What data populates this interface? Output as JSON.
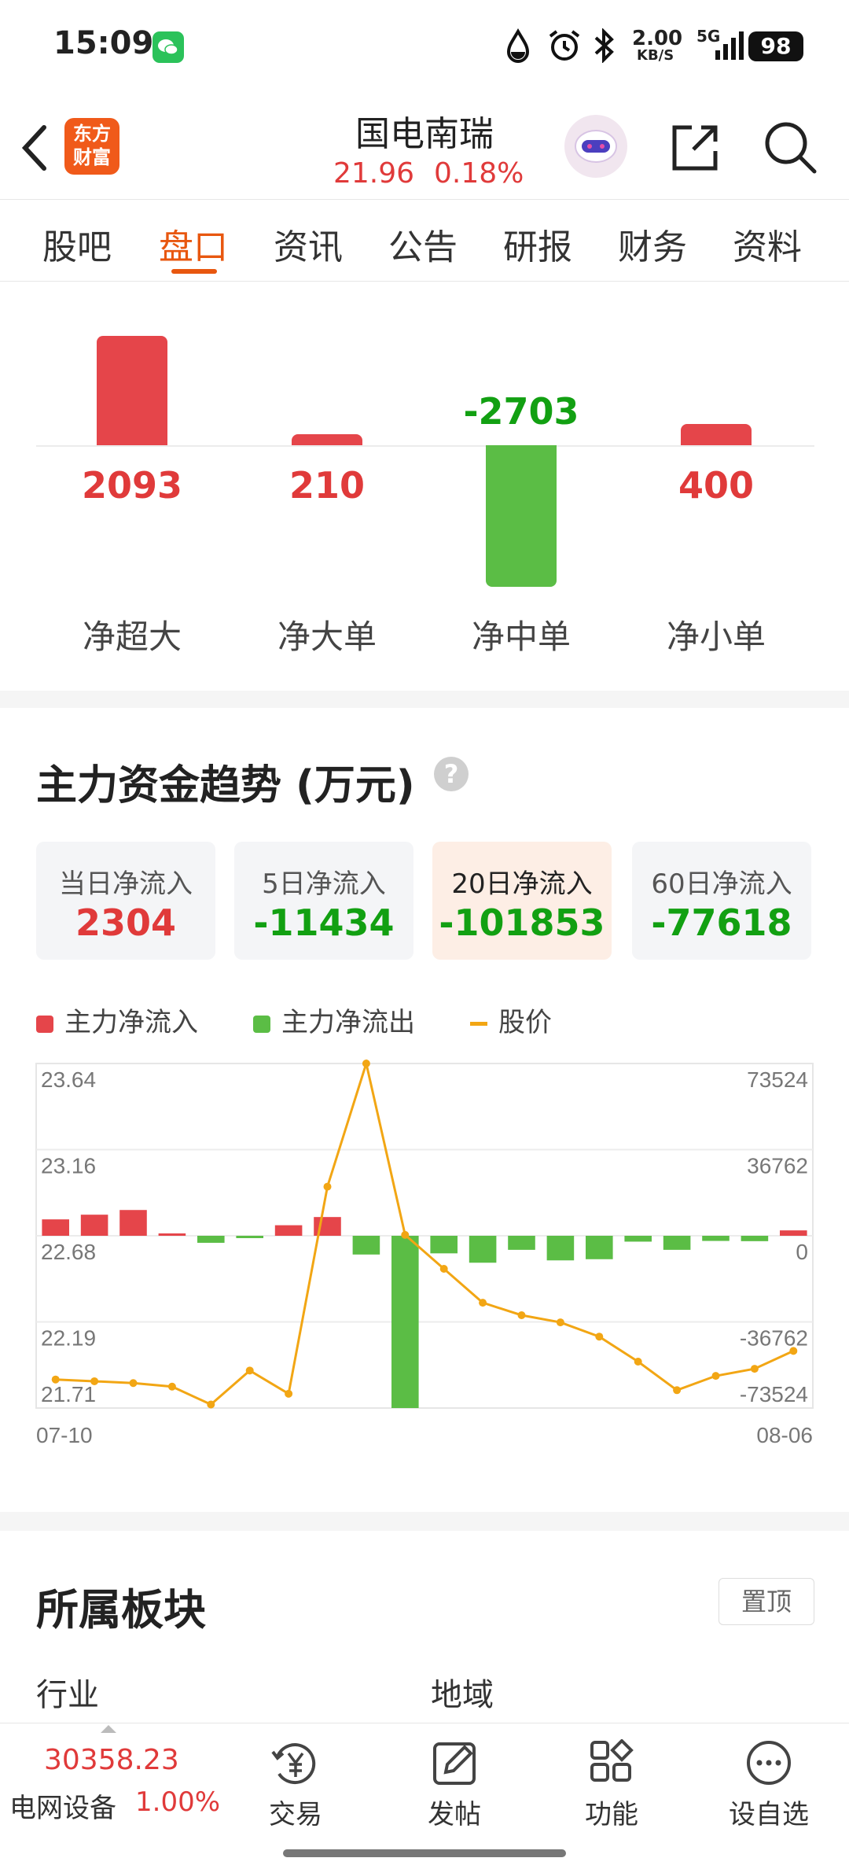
{
  "status_bar": {
    "time": "15:09",
    "net_speed": "2.00",
    "net_unit": "KB/S",
    "network": "5G",
    "battery": "98"
  },
  "header": {
    "logo_line1": "东方",
    "logo_line2": "财富",
    "title": "国电南瑞",
    "price": "21.96",
    "change": "0.18%"
  },
  "tabs": [
    {
      "label": "股吧"
    },
    {
      "label": "盘口"
    },
    {
      "label": "资讯"
    },
    {
      "label": "公告"
    },
    {
      "label": "研报"
    },
    {
      "label": "财务"
    },
    {
      "label": "资料"
    }
  ],
  "active_tab": "盘口",
  "net_flow": {
    "items": [
      {
        "label": "净超大",
        "value": 2093,
        "display": "2093"
      },
      {
        "label": "净大单",
        "value": 210,
        "display": "210"
      },
      {
        "label": "净中单",
        "value": -2703,
        "display": "-2703"
      },
      {
        "label": "净小单",
        "value": 400,
        "display": "400"
      }
    ]
  },
  "trend": {
    "title": "主力资金趋势 (万元)",
    "help_icon": "question-icon",
    "stats": [
      {
        "label": "当日净流入",
        "value": "2304",
        "color": "#e03a3a"
      },
      {
        "label": "5日净流入",
        "value": "-11434",
        "color": "#12a012"
      },
      {
        "label": "20日净流入",
        "value": "-101853",
        "color": "#12a012"
      },
      {
        "label": "60日净流入",
        "value": "-77618",
        "color": "#12a012"
      }
    ],
    "selected_stat": "20日净流入",
    "legend": {
      "inflow": "主力净流入",
      "outflow": "主力净流出",
      "price": "股价"
    }
  },
  "chart_data": {
    "type": "bar+line",
    "x_start": "07-10",
    "x_end": "08-06",
    "left_ticks": [
      "23.64",
      "23.16",
      "22.68",
      "22.19",
      "21.71"
    ],
    "right_ticks": [
      "73524",
      "36762",
      "0",
      "-36762",
      "-73524"
    ],
    "left_range": [
      21.71,
      23.64
    ],
    "right_range": [
      -73524,
      73524
    ],
    "series": [
      {
        "name": "主力净流入/主力净流出",
        "values": [
          7000,
          9000,
          11000,
          500,
          -3000,
          -500,
          4500,
          8000,
          -8000,
          -73524,
          -7500,
          -11500,
          -6000,
          -10500,
          -10000,
          -2500,
          -6000,
          -2200,
          -2300,
          2300
        ]
      },
      {
        "name": "股价",
        "values": [
          21.87,
          21.86,
          21.85,
          21.83,
          21.73,
          21.92,
          21.79,
          22.95,
          23.64,
          22.68,
          22.49,
          22.3,
          22.23,
          22.19,
          22.11,
          21.97,
          21.81,
          21.89,
          21.93,
          22.03
        ]
      }
    ],
    "colors": {
      "inflow": "#e5454a",
      "outflow": "#5bbd45",
      "price": "#f2a614"
    }
  },
  "sector": {
    "title": "所属板块",
    "pin_label": "置顶",
    "industry_label": "行业",
    "region_label": "地域"
  },
  "bottom": {
    "index_value": "30358.23",
    "index_name": "电网设备",
    "index_change": "1.00%",
    "nav": [
      {
        "label": "交易",
        "icon": "yuan-circle-icon"
      },
      {
        "label": "发帖",
        "icon": "edit-icon"
      },
      {
        "label": "功能",
        "icon": "grid-icon"
      },
      {
        "label": "设自选",
        "icon": "more-icon"
      }
    ]
  }
}
